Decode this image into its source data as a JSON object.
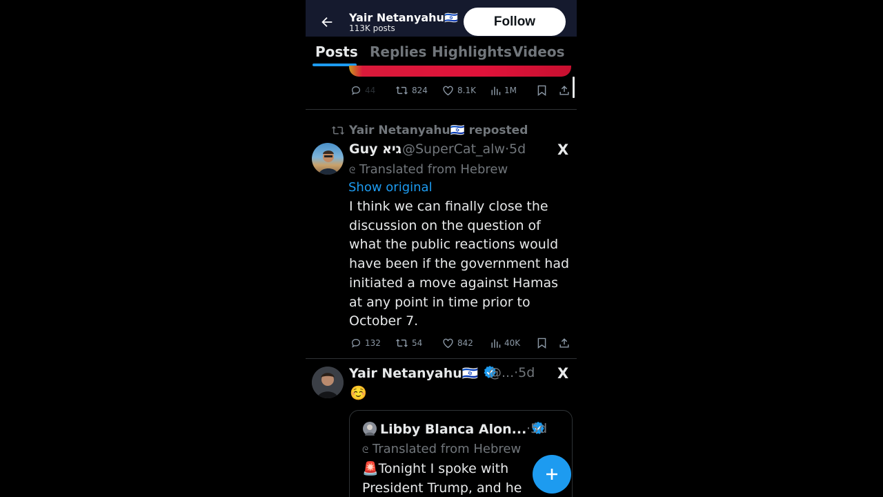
{
  "header": {
    "name": "Yair Netanyahu🇮🇱",
    "posts": "113K posts",
    "follow_label": "Follow"
  },
  "tabs": [
    {
      "label": "Posts",
      "active": true
    },
    {
      "label": "Replies",
      "active": false
    },
    {
      "label": "Highlights",
      "active": false
    },
    {
      "label": "Videos",
      "active": false
    }
  ],
  "post1_actions": {
    "replies": "44",
    "reposts": "824",
    "likes": "8.1K",
    "views": "1M"
  },
  "post2": {
    "repost_label": "Yair Netanyahu🇮🇱 reposted",
    "author_name": "Guy גיא",
    "handle_time": "@SuperCat_alw·5d",
    "translated": "Translated from Hebrew",
    "show_original": "Show original",
    "body": "I think we can finally close the discussion on the question of what the public reactions would have been if the government had initiated a move against Hamas at any point in time prior to October 7.",
    "actions": {
      "replies": "132",
      "reposts": "54",
      "likes": "842",
      "views": "40K"
    }
  },
  "post3": {
    "author_name": "Yair Netanyahu🇮🇱",
    "handle_time": "@...·5d",
    "body": "☺️",
    "quote": {
      "author_name": "Libby Blanca Alon...",
      "time": "·5d",
      "translated": "Translated from Hebrew",
      "body": "🚨Tonight I spoke with President Trump, and he"
    }
  },
  "x_logo": "X",
  "colors": {
    "accent": "#1d9bf0",
    "header_bg": "#151a2e",
    "muted": "#71767b"
  }
}
